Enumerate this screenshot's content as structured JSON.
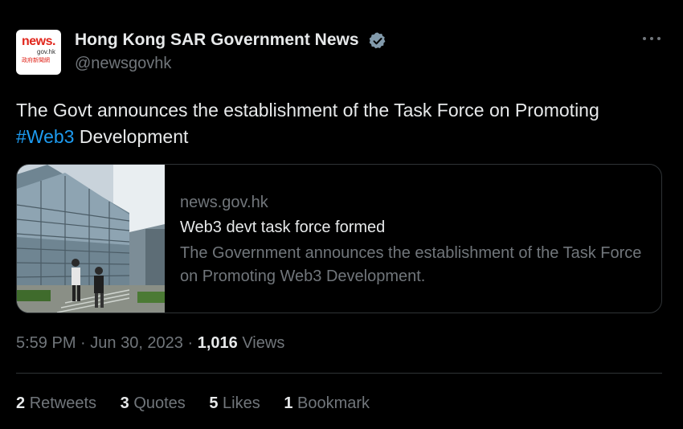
{
  "author": {
    "display_name": "Hong Kong SAR Government News",
    "handle": "@newsgovhk",
    "verified": true,
    "avatar_text": {
      "line1": "news.",
      "line2": "gov.hk",
      "line3": "政府新聞網"
    }
  },
  "tweet": {
    "text_before": "The Govt announces the establishment of the Task Force on Promoting ",
    "hashtag": "#Web3",
    "text_after": " Development"
  },
  "card": {
    "domain": "news.gov.hk",
    "title": "Web3 devt task force formed",
    "description": "The Government announces the establishment of the Task Force on Promoting Web3 Development."
  },
  "meta": {
    "time": "5:59 PM",
    "date": "Jun 30, 2023",
    "separator": " · ",
    "views_count": "1,016",
    "views_label": "Views"
  },
  "stats": {
    "retweets_count": "2",
    "retweets_label": "Retweets",
    "quotes_count": "3",
    "quotes_label": "Quotes",
    "likes_count": "5",
    "likes_label": "Likes",
    "bookmarks_count": "1",
    "bookmarks_label": "Bookmark"
  },
  "colors": {
    "background": "#000000",
    "text_primary": "#e7e9ea",
    "text_secondary": "#71767b",
    "link": "#1d9bf0",
    "verified": "#829aab",
    "border": "#2f3336"
  },
  "icons": {
    "verified": "verified-badge-icon",
    "more": "more-options-icon"
  }
}
